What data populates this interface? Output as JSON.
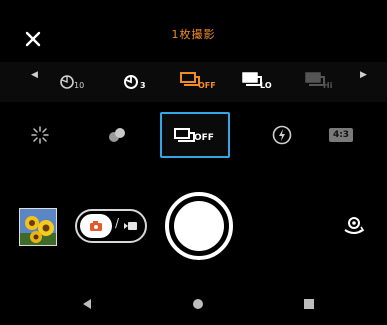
{
  "header": {
    "title": "1枚撮影",
    "icons": {
      "close": "close-icon"
    }
  },
  "drive_modes": {
    "items": [
      {
        "name": "self-timer-10",
        "label": "10",
        "icon": "self-timer-icon",
        "state": "normal"
      },
      {
        "name": "self-timer-3",
        "label": "3",
        "icon": "self-timer-icon",
        "state": "normal"
      },
      {
        "name": "single-shot-off",
        "label": "OFF",
        "icon": "single-shot-icon",
        "state": "selected"
      },
      {
        "name": "continuous-lo",
        "label": "LO",
        "icon": "continuous-shot-icon",
        "state": "normal"
      },
      {
        "name": "continuous-hi",
        "label": "Hi",
        "icon": "continuous-shot-icon",
        "state": "dimmed"
      }
    ]
  },
  "settings_row": {
    "selected_badge": "OFF",
    "aspect_ratio": "4:3",
    "icons": [
      "dro-icon",
      "bokeh-icon",
      "drive-mode-icon",
      "flash-icon",
      "aspect-ratio-icon"
    ]
  },
  "colors": {
    "accent_orange": "#f08a24",
    "selection_blue": "#32a7e8",
    "background": "#000000"
  }
}
